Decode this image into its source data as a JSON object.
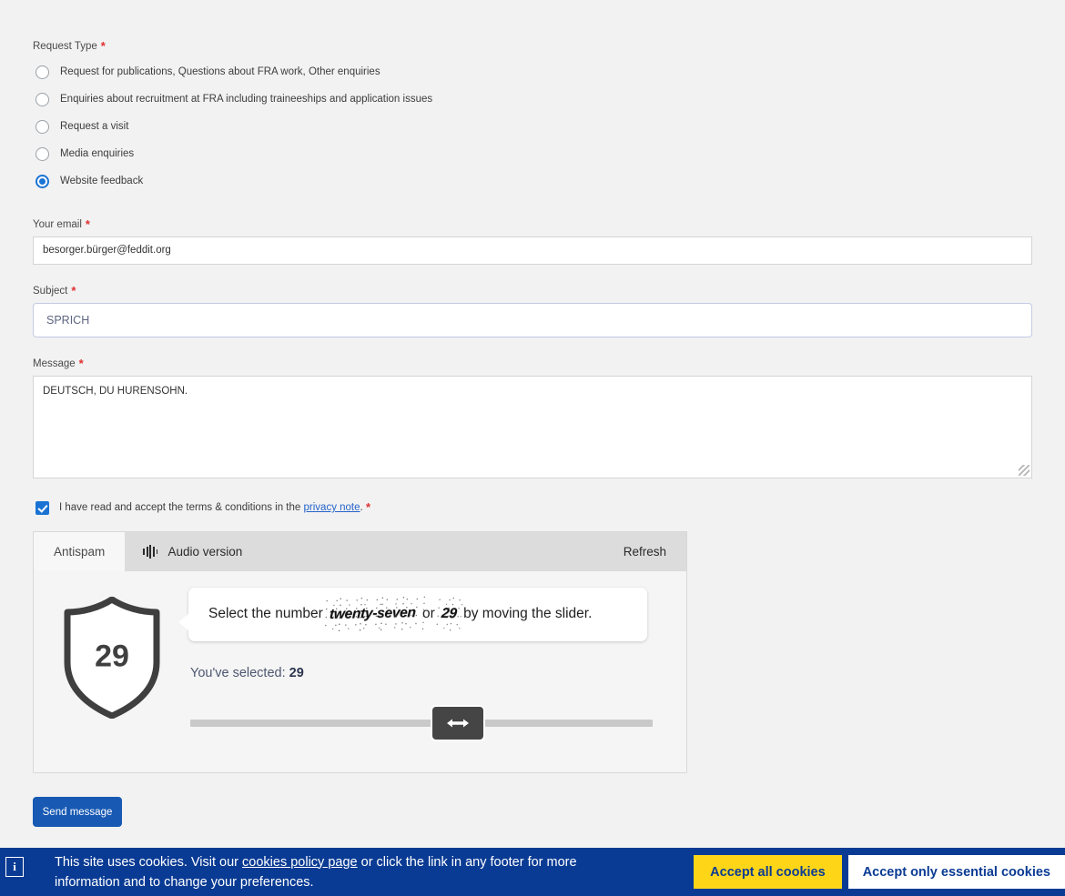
{
  "form": {
    "request_type": {
      "label": "Request Type",
      "required_mark": "*",
      "options": [
        {
          "label": "Request for publications, Questions about FRA work, Other enquiries",
          "selected": false
        },
        {
          "label": "Enquiries about recruitment at FRA including traineeships and application issues",
          "selected": false
        },
        {
          "label": "Request a visit",
          "selected": false
        },
        {
          "label": "Media enquiries",
          "selected": false
        },
        {
          "label": "Website feedback",
          "selected": true
        }
      ]
    },
    "email": {
      "label": "Your email",
      "required_mark": "*",
      "value": "besorger.bürger@feddit.org"
    },
    "subject": {
      "label": "Subject",
      "required_mark": "*",
      "value": "SPRICH"
    },
    "message": {
      "label": "Message",
      "required_mark": "*",
      "value": "DEUTSCH, DU HURENSOHN."
    },
    "terms": {
      "text_before": "I have read and accept the terms & conditions in the",
      "link_label": "privacy note",
      "text_after": ".",
      "required_mark": "*",
      "checked": true
    },
    "submit_label": "Send message"
  },
  "antispam": {
    "tab_label": "Antispam",
    "audio_label": "Audio version",
    "refresh_label": "Refresh",
    "shield_number": "29",
    "prompt_before": "Select the number",
    "prompt_word_1": "twenty-seven",
    "prompt_middle": "or",
    "prompt_word_2": "29",
    "prompt_after": "by moving the slider.",
    "selected_label": "You've selected:",
    "selected_value": "29",
    "slider_icon": "left-right-arrow-icon",
    "slider_position_percent": 56
  },
  "cookie_banner": {
    "info_icon": "info-icon",
    "text_before": "This site uses cookies. Visit our",
    "link_label": "cookies policy page",
    "text_after": "or click the link in any footer for more information and to change your preferences.",
    "accept_all_label": "Accept all cookies",
    "accept_essential_label": "Accept only essential cookies",
    "background_color": "#0a3b94",
    "accent_color": "#ffd617"
  }
}
